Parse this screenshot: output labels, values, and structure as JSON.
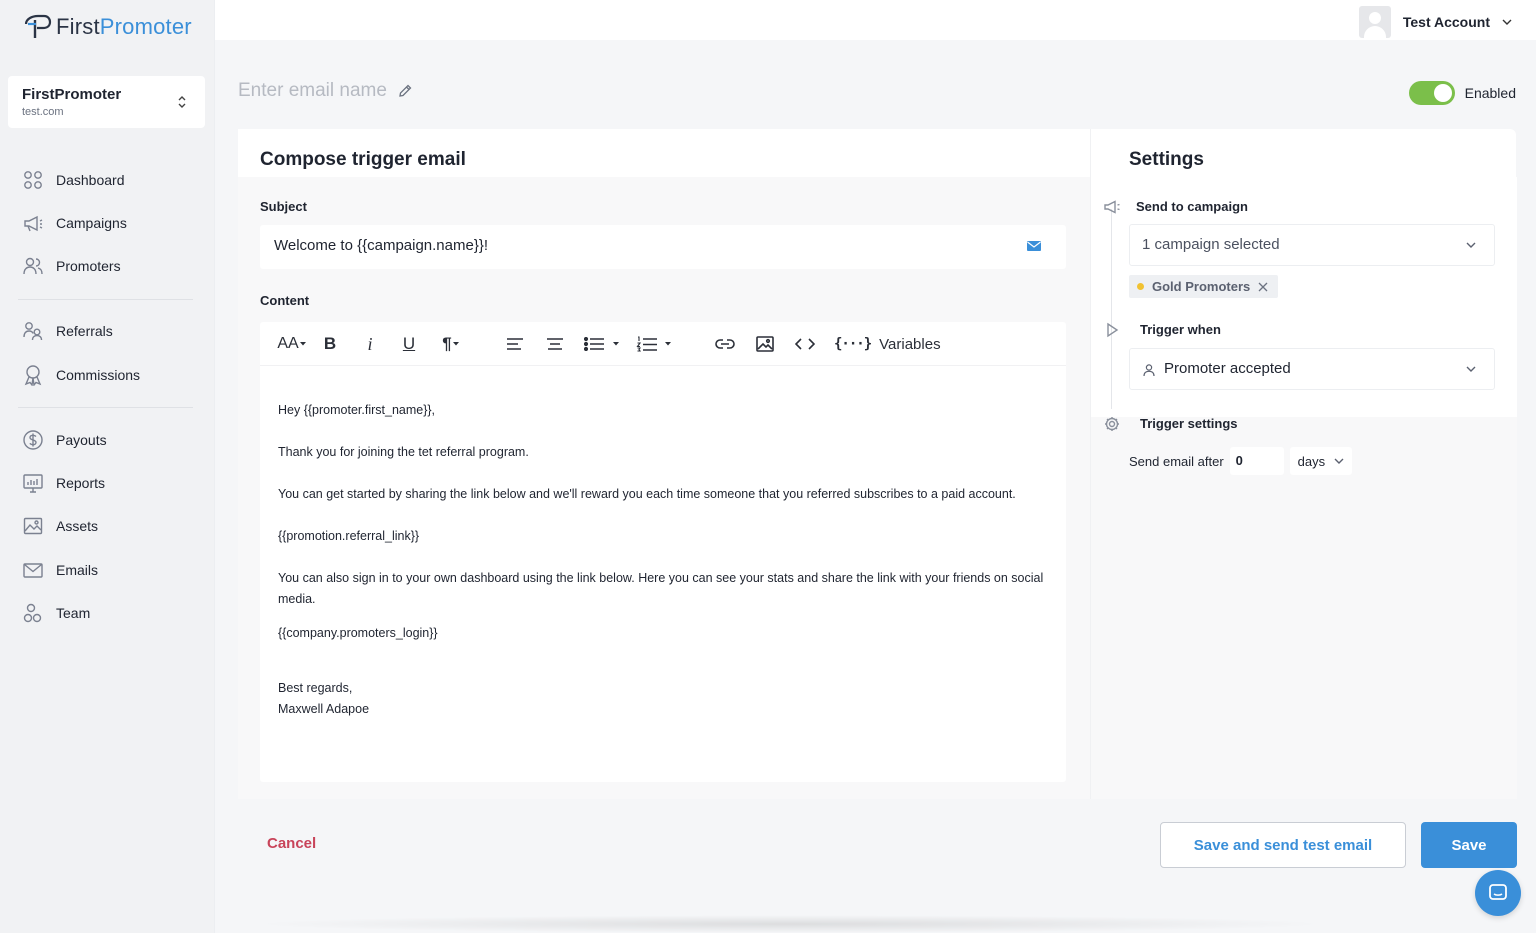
{
  "app": {
    "logo_first": "First",
    "logo_promoter": "Promoter",
    "brand_color": "#3a8fd9"
  },
  "org": {
    "name": "FirstPromoter",
    "domain": "test.com"
  },
  "nav": {
    "dashboard": "Dashboard",
    "campaigns": "Campaigns",
    "promoters": "Promoters",
    "referrals": "Referrals",
    "commissions": "Commissions",
    "payouts": "Payouts",
    "reports": "Reports",
    "assets": "Assets",
    "emails": "Emails",
    "team": "Team"
  },
  "account": {
    "name": "Test Account"
  },
  "email": {
    "name_placeholder": "Enter email name",
    "enabled_label": "Enabled",
    "enabled": true
  },
  "compose": {
    "title": "Compose trigger email",
    "subject_label": "Subject",
    "subject_value": "Welcome to {{campaign.name}}!",
    "content_label": "Content",
    "toolbar": {
      "font_size": "AA",
      "bold": "B",
      "italic": "i",
      "underline": "U",
      "paragraph": "¶",
      "variables_label": "Variables",
      "variables_glyph": "{···}"
    },
    "body": {
      "line1": "Hey {{promoter.first_name}},",
      "line2": "Thank you for joining the tet referral program.",
      "line3": "You can get started by sharing the link below and we'll reward you each time someone that you referred subscribes to a paid account.",
      "line4": "{{promotion.referral_link}}",
      "line5": "You can also sign in to your own dashboard using the link below. Here you can see your stats and share the link with your friends on social media.",
      "line6": "{{company.promoters_login}}",
      "line7": "Best regards,",
      "line8": "Maxwell Adapoe"
    }
  },
  "settings": {
    "title": "Settings",
    "send_to_campaign_label": "Send to campaign",
    "campaign_select": "1 campaign selected",
    "campaign_chip": "Gold Promoters",
    "chip_dot_color": "#f1c232",
    "trigger_when_label": "Trigger when",
    "trigger_select": "Promoter accepted",
    "trigger_settings_label": "Trigger settings",
    "send_after_label": "Send email after",
    "send_after_value": "0",
    "send_after_unit": "days"
  },
  "footer": {
    "cancel": "Cancel",
    "save_and_test": "Save and send test email",
    "save": "Save"
  }
}
